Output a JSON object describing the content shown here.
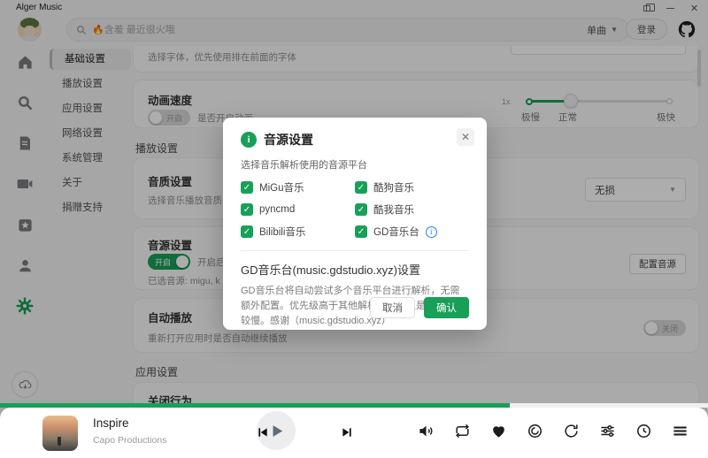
{
  "colors": {
    "accent": "#18a058",
    "info_blue": "#2080f0"
  },
  "titlebar": {
    "app_title": "Alger Music"
  },
  "header": {
    "search_placeholder": "🔥含羞 最近很火哦",
    "search_scope": "单曲",
    "login_label": "登录"
  },
  "settings_nav": {
    "items": [
      "基础设置",
      "播放设置",
      "应用设置",
      "网络设置",
      "系统管理",
      "关于",
      "捐赠支持"
    ],
    "active": "基础设置"
  },
  "settings": {
    "font_card": {
      "desc": "选择字体，优先使用排在前面的字体"
    },
    "animation_card": {
      "title": "动画速度",
      "toggle_label": "开启",
      "toggle_state": "off",
      "desc": "是否开启动画",
      "speed_value": "1x",
      "marks": [
        "极慢",
        "正常",
        "极快"
      ]
    },
    "play_section_title": "播放设置",
    "quality_card": {
      "title": "音质设置",
      "desc": "选择音乐播放音质",
      "select_value": "无损"
    },
    "source_card": {
      "title": "音源设置",
      "toggle_label": "开启",
      "toggle_state": "on",
      "desc_fragment": "开启后",
      "selected_fragment": "已选音源: migu, k",
      "config_button": "配置音源"
    },
    "autoplay_card": {
      "title": "自动播放",
      "desc": "重新打开应用时是否自动继续播放",
      "toggle_label": "关闭",
      "toggle_state": "off"
    },
    "app_section_title": "应用设置",
    "close_card": {
      "title": "关闭行为"
    }
  },
  "modal": {
    "title": "音源设置",
    "subtitle": "选择音乐解析使用的音源平台",
    "sources": [
      {
        "label": "MiGu音乐",
        "checked": true
      },
      {
        "label": "酷狗音乐",
        "checked": true
      },
      {
        "label": "pyncmd",
        "checked": true
      },
      {
        "label": "酷我音乐",
        "checked": true
      },
      {
        "label": "Bilibili音乐",
        "checked": true
      },
      {
        "label": "GD音乐台",
        "checked": true,
        "has_info": true
      }
    ],
    "check_glyph": "✓",
    "gd_heading": "GD音乐台(music.gdstudio.xyz)设置",
    "gd_desc": "GD音乐台将自动尝试多个音乐平台进行解析，无需额外配置。优先级高于其他解析方式，但是请求可能较慢。感谢（music.gdstudio.xyz）",
    "cancel_label": "取消",
    "confirm_label": "确认"
  },
  "player": {
    "track_title": "Inspire",
    "artist": "Capo Productions",
    "progress_percent": 72
  }
}
